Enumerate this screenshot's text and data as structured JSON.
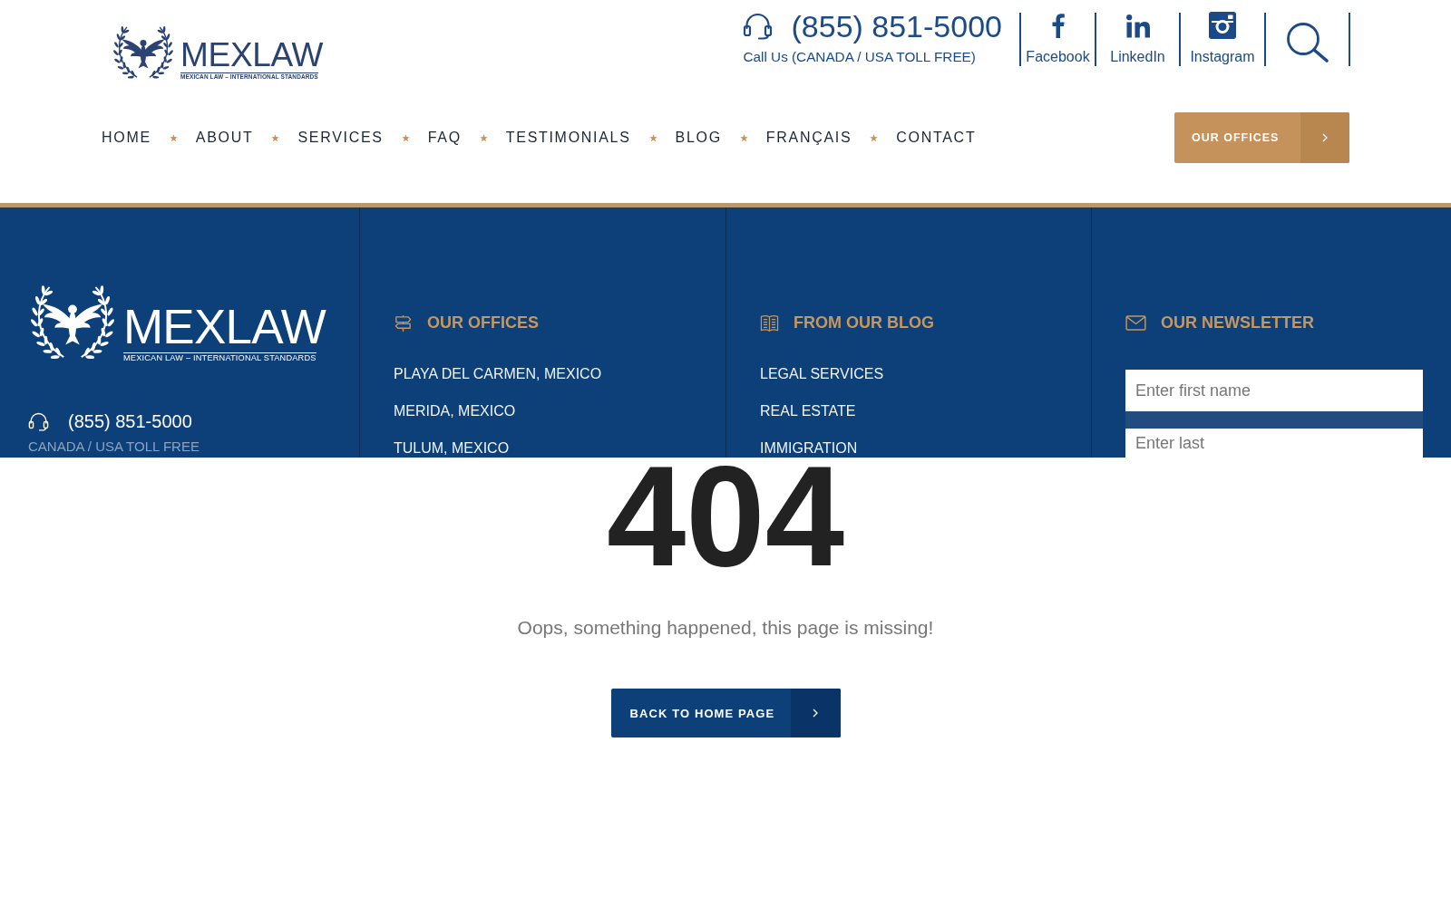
{
  "header": {
    "logo": {
      "name": "MEXLAW",
      "tagline": "MEXICAN LAW – INTERNATIONAL STANDARDS"
    },
    "contact": {
      "phone": "(855) 851-5000",
      "note": "Call Us (CANADA / USA TOLL FREE)"
    },
    "social_links": [
      {
        "kind": "facebook",
        "label": "Facebook"
      },
      {
        "kind": "linkedin",
        "label": "LinkedIn"
      },
      {
        "kind": "instagram",
        "label": "Instagram"
      }
    ],
    "nav": {
      "items": [
        "HOME",
        "ABOUT",
        "SERVICES",
        "FAQ",
        "TESTIMONIALS",
        "BLOG",
        "FRANÇAIS",
        "CONTACT"
      ]
    },
    "offices_button": {
      "label": "OUR OFFICES"
    }
  },
  "footer": {
    "brand": {
      "name": "MEXLAW",
      "tagline": "MEXICAN LAW – INTERNATIONAL STANDARDS",
      "phone": "(855) 851-5000",
      "phone_note": "CANADA / USA TOLL FREE"
    },
    "columns": [
      {
        "kind": "offices",
        "title": "OUR OFFICES",
        "links": [
          "PLAYA DEL CARMEN, MEXICO",
          "MERIDA, MEXICO",
          "TULUM, MEXICO"
        ]
      },
      {
        "kind": "blog",
        "title": "FROM OUR BLOG",
        "links": [
          "LEGAL SERVICES",
          "REAL ESTATE",
          "IMMIGRATION"
        ]
      }
    ],
    "newsletter": {
      "title": "OUR NEWSLETTER",
      "fields": [
        {
          "placeholder": "Enter first name"
        },
        {
          "placeholder": "Enter last"
        }
      ]
    }
  },
  "error_page": {
    "code": "404",
    "message": "Oops, something happened, this page is missing!",
    "button": "BACK TO HOME PAGE"
  }
}
